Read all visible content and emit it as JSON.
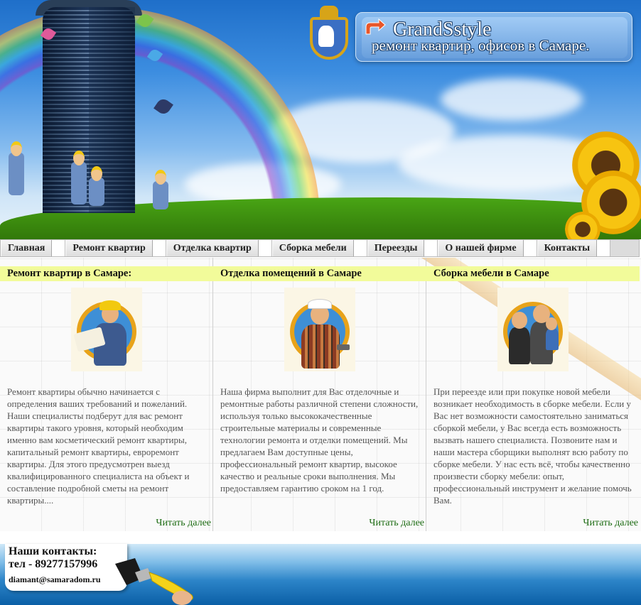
{
  "header": {
    "logo_title": "GrandSstyle",
    "logo_subtitle": "ремонт квартир, офисов в Самаре."
  },
  "nav": {
    "items": [
      {
        "label": "Главная"
      },
      {
        "label": "Ремонт квартир"
      },
      {
        "label": "Отделка квартир"
      },
      {
        "label": "Сборка мебели"
      },
      {
        "label": "Переезды"
      },
      {
        "label": "О нашей фирме"
      },
      {
        "label": "Контакты"
      }
    ]
  },
  "columns": [
    {
      "title": "Ремонт квартир в Самаре:",
      "text": "Ремонт квартиры обычно начинается с определения ваших требований и пожеланий. Наши специалисты подберут для вас ремонт квартиры такого уровня, который необходим именно вам косметический ремонт квартиры, капитальный ремонт квартиры, евроремонт квартиры. Для этого предусмотрен выезд квалифицированного специалиста на объект и составление подробной сметы на ремонт квартиры....",
      "read_more": "Читать далее"
    },
    {
      "title": "Отделка помещений в Самаре",
      "text": "Наша фирма выполнит для Вас отделочные и ремонтные работы различной степени сложности, используя только высококачественные строительные материалы и современные технологии ремонта и отделки помещений. Мы предлагаем Вам доступные цены, профессиональный ремонт квартир, высокое качество и реальные сроки выполнения. Мы предоставляем гарантию сроком на 1 год.",
      "read_more": "Читать далее"
    },
    {
      "title": "Сборка мебели в Самаре",
      "text": "При переезде или при покупке новой мебели возникает необходимость в сборке мебели. Если у Вас нет возможности самостоятельно заниматься сборкой мебели, у Вас всегда есть возможность вызвать нашего специалиста. Позвоните нам и наши мастера сборщики выполнят всю работу по сборке мебели. У нас есть всё, чтобы качественно произвести сборку мебели: опыт, профессиональный инструмент и желание помочь Вам.",
      "read_more": "Читать далее"
    }
  ],
  "footer": {
    "contacts_title": "Наши контакты:",
    "phone": "тел - 89277157996",
    "email": "diamant@samaradom.ru"
  },
  "colors": {
    "title_bar": "#f2fb9a",
    "link_green": "#1c6b12",
    "nav_bg": "#dcdcdc",
    "footer_blue": "#0b5fa6"
  },
  "icons": [
    "arrow-icon",
    "samara-emblem-icon",
    "paint-brush-icon"
  ]
}
